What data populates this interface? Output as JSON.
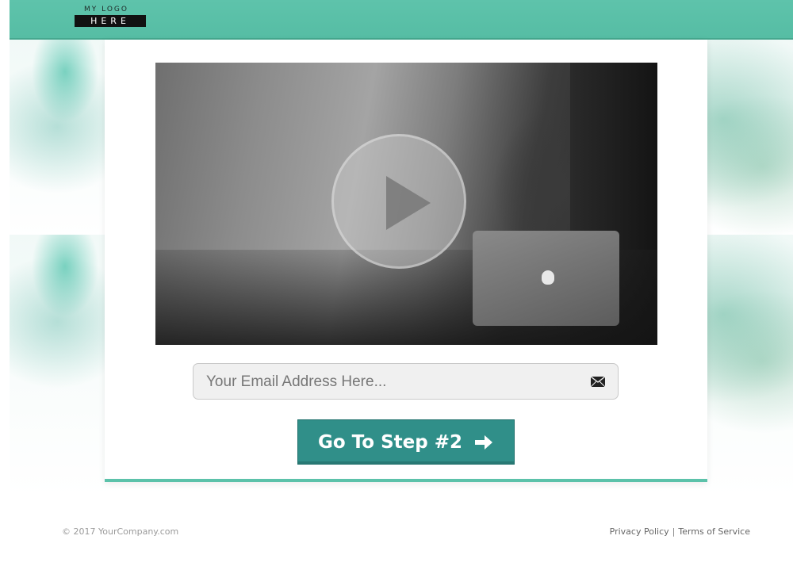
{
  "header": {
    "logo_top": "MY LOGO",
    "logo_bottom": "HERE",
    "accent": "#5ec3ab"
  },
  "video": {
    "icon": "play-icon"
  },
  "form": {
    "email_placeholder": "Your Email Address Here...",
    "email_icon": "envelope-icon",
    "cta_label": "Go To Step #2",
    "cta_icon": "arrow-right-icon",
    "cta_color": "#308f89"
  },
  "footer": {
    "copyright": "© 2017 YourCompany.com",
    "privacy": "Privacy Policy",
    "separator": "|",
    "terms": "Terms of Service"
  }
}
